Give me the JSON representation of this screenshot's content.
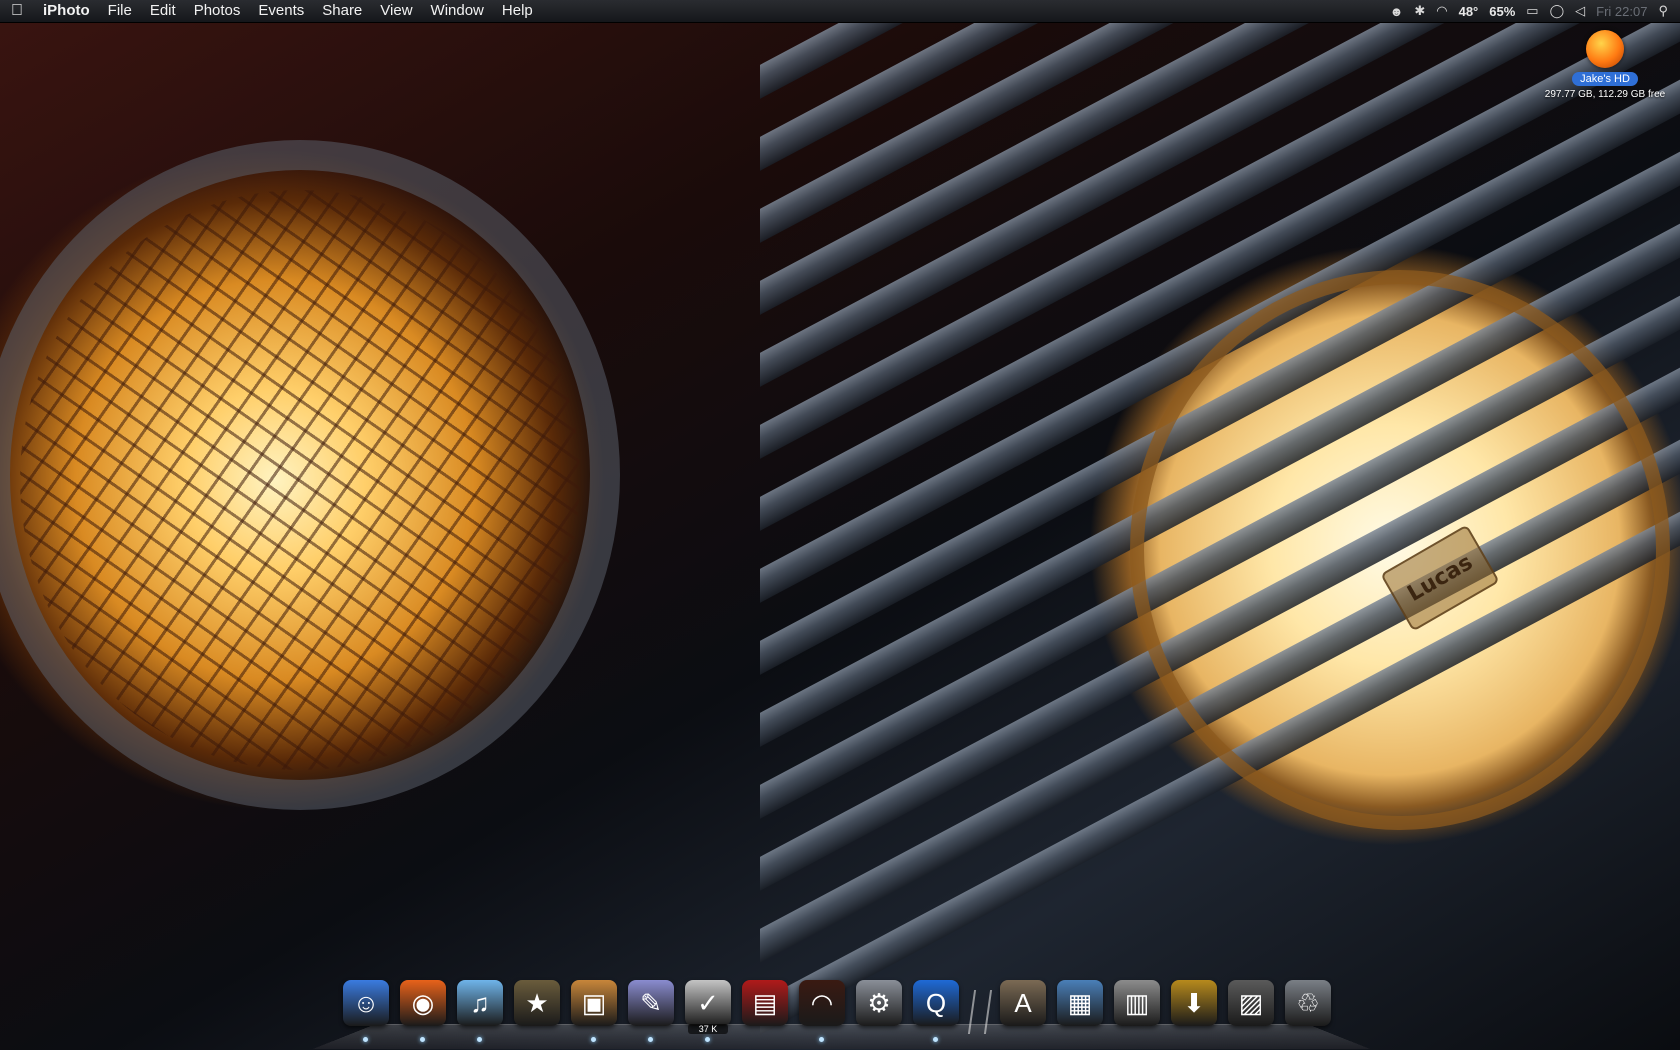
{
  "menubar": {
    "apple_icon": "apple-icon",
    "app_name": "iPhoto",
    "menus": [
      "File",
      "Edit",
      "Photos",
      "Events",
      "Share",
      "View",
      "Window",
      "Help"
    ],
    "status": {
      "temperature": "48°",
      "battery": "65%",
      "clock": "Fri 22:07",
      "icons": [
        "menu-extra-icon",
        "bluetooth-icon",
        "wifi-icon",
        "display-icon",
        "chat-icon",
        "volume-icon",
        "spotlight-icon"
      ]
    }
  },
  "desktop": {
    "drive": {
      "name": "Jake's HD",
      "info": "297.77 GB, 112.29 GB free",
      "icon": "hard-drive-icon"
    },
    "wallpaper_badge": "Lucas"
  },
  "dock": {
    "items": [
      {
        "name": "finder",
        "icon": "finder-icon",
        "glyph": "☺",
        "color": "#3a7be0",
        "running": true
      },
      {
        "name": "firefox",
        "icon": "firefox-icon",
        "glyph": "◉",
        "color": "#e8621a",
        "running": true
      },
      {
        "name": "itunes",
        "icon": "itunes-icon",
        "glyph": "♫",
        "color": "#6fb4ea",
        "running": true
      },
      {
        "name": "imovie",
        "icon": "imovie-icon",
        "glyph": "★",
        "color": "#6a5c3c",
        "running": false
      },
      {
        "name": "iphoto",
        "icon": "iphoto-icon",
        "glyph": "▣",
        "color": "#c8863a",
        "running": true
      },
      {
        "name": "script-editor",
        "icon": "script-editor-icon",
        "glyph": "✎",
        "color": "#8a8cd0",
        "running": true
      },
      {
        "name": "ical",
        "icon": "ical-icon",
        "glyph": "✓",
        "color": "#c4c4c4",
        "running": true,
        "badge": "37 K"
      },
      {
        "name": "front-row",
        "icon": "front-row-icon",
        "glyph": "▤",
        "color": "#b01a1a",
        "running": false
      },
      {
        "name": "preview",
        "icon": "preview-icon",
        "glyph": "◠",
        "color": "#3a1a12",
        "running": true
      },
      {
        "name": "system-preferences",
        "icon": "system-preferences-icon",
        "glyph": "⚙",
        "color": "#8a8f98",
        "running": false
      },
      {
        "name": "quicktime",
        "icon": "quicktime-icon",
        "glyph": "Q",
        "color": "#1f6ad6",
        "running": true
      }
    ],
    "stacks": [
      {
        "name": "applications-folder",
        "icon": "applications-folder-icon",
        "glyph": "A",
        "color": "#7b6a54"
      },
      {
        "name": "documents-folder",
        "icon": "documents-folder-icon",
        "glyph": "▦",
        "color": "#4a7fb8"
      },
      {
        "name": "files-folder",
        "icon": "files-folder-icon",
        "glyph": "▥",
        "color": "#8c8c8c"
      },
      {
        "name": "downloads-folder",
        "icon": "downloads-folder-icon",
        "glyph": "⬇",
        "color": "#b78a1c"
      },
      {
        "name": "pictures-folder",
        "icon": "pictures-folder-icon",
        "glyph": "▨",
        "color": "#5a5a5a"
      },
      {
        "name": "trash",
        "icon": "trash-icon",
        "glyph": "♲",
        "color": "#7a7f86"
      }
    ]
  }
}
